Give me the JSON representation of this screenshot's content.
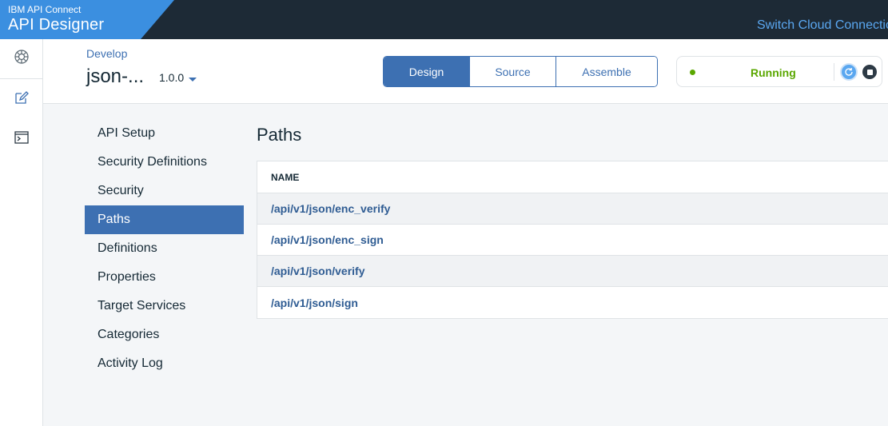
{
  "header": {
    "brand_small": "IBM API Connect",
    "brand_big": "API Designer",
    "switch_cloud": "Switch Cloud Connectio"
  },
  "rail": {
    "items": [
      {
        "icon": "globe-icon"
      },
      {
        "icon": "edit-icon"
      },
      {
        "icon": "terminal-icon"
      }
    ]
  },
  "subheader": {
    "breadcrumb": "Develop",
    "api_name": "json-...",
    "version": "1.0.0"
  },
  "tabs": [
    {
      "label": "Design",
      "active": true
    },
    {
      "label": "Source",
      "active": false
    },
    {
      "label": "Assemble",
      "active": false
    }
  ],
  "status": {
    "label": "Running",
    "color": "#5aa700"
  },
  "section_nav": [
    {
      "label": "API Setup"
    },
    {
      "label": "Security Definitions"
    },
    {
      "label": "Security"
    },
    {
      "label": "Paths",
      "active": true
    },
    {
      "label": "Definitions"
    },
    {
      "label": "Properties"
    },
    {
      "label": "Target Services"
    },
    {
      "label": "Categories"
    },
    {
      "label": "Activity Log"
    }
  ],
  "paths_panel": {
    "title": "Paths",
    "column_header": "NAME",
    "rows": [
      "/api/v1/json/enc_verify",
      "/api/v1/json/enc_sign",
      "/api/v1/json/verify",
      "/api/v1/json/sign"
    ]
  },
  "colors": {
    "accent": "#3d70b2",
    "brand": "#3b8fe0",
    "topbar": "#1d2a36"
  }
}
